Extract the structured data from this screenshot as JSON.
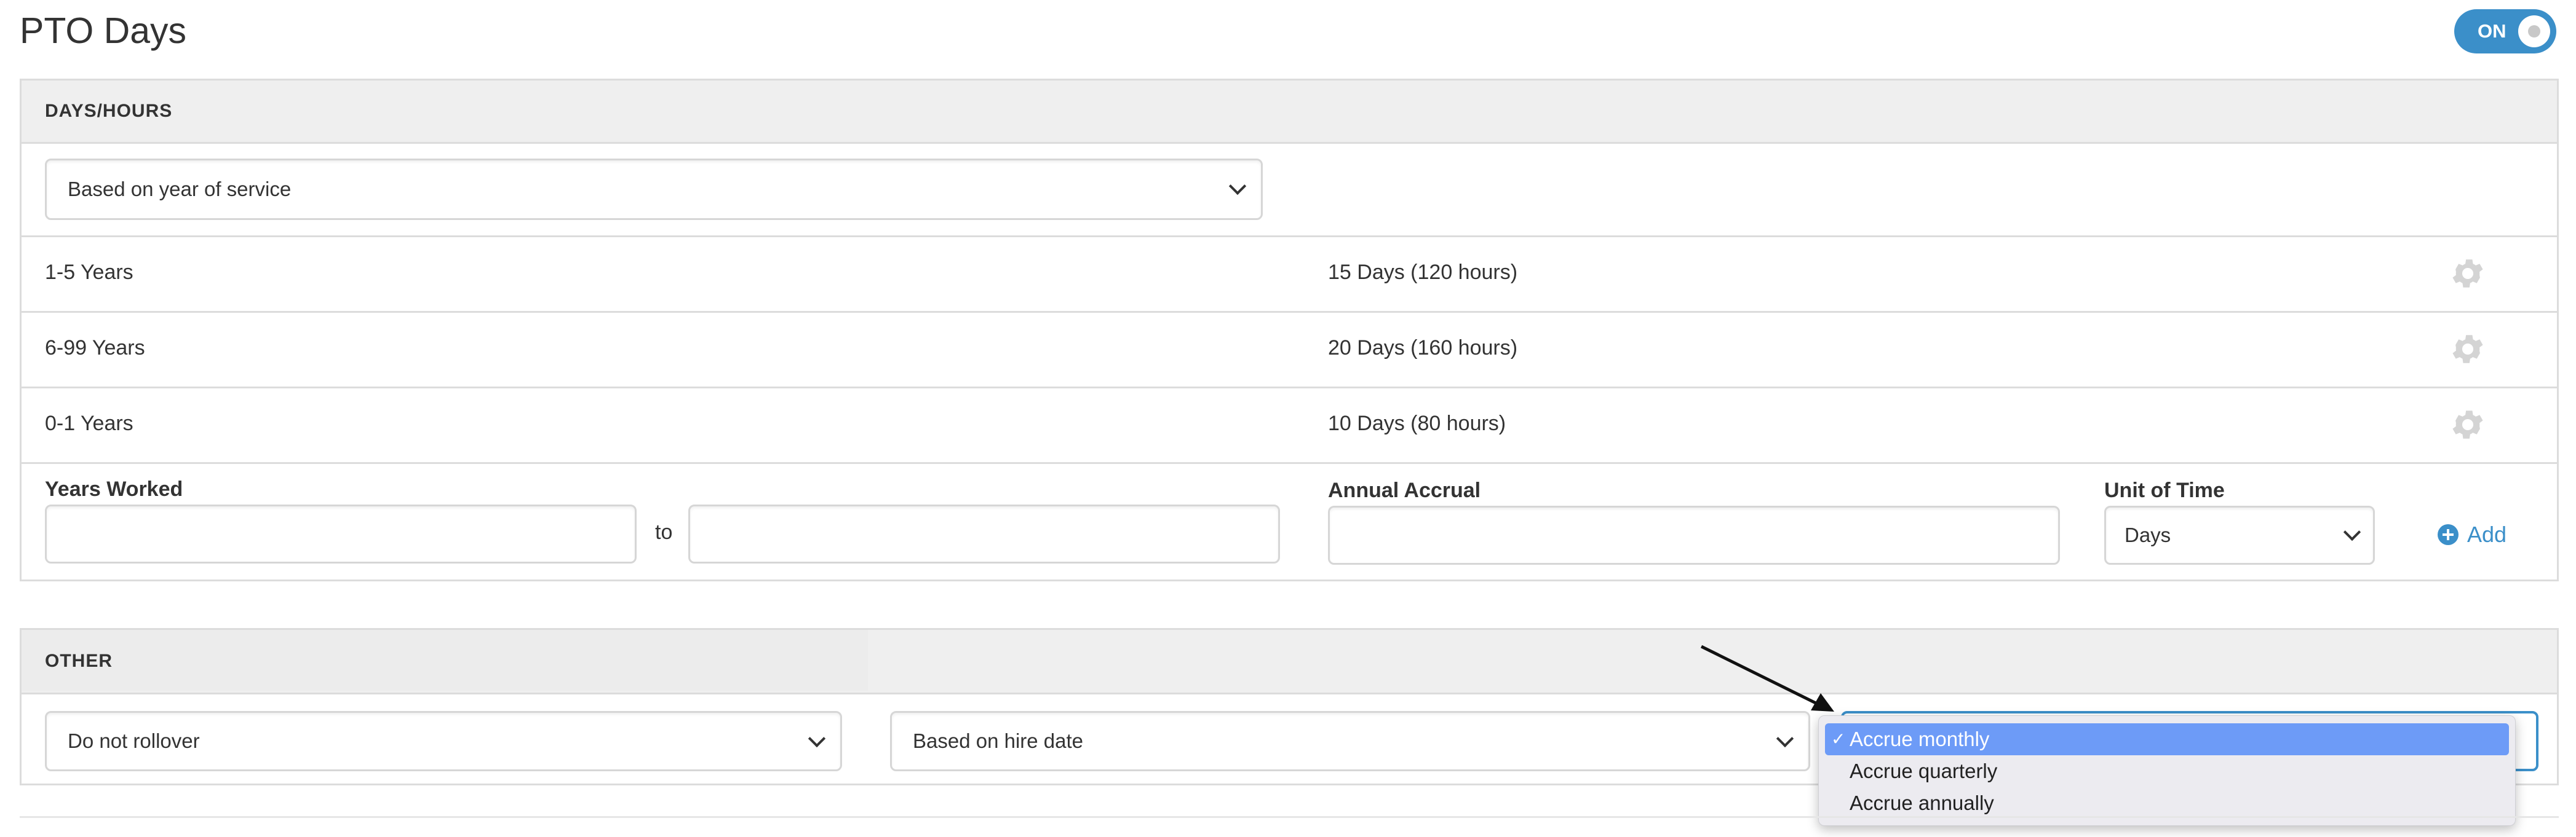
{
  "page": {
    "title": "PTO Days"
  },
  "toggle": {
    "label": "ON",
    "state": "on",
    "color": "#3b8fc9"
  },
  "days_hours": {
    "header": "DAYS/HOURS",
    "policy_select": {
      "value": "Based on year of service"
    },
    "rows": [
      {
        "years": "1-5 Years",
        "accrual": "15 Days (120 hours)"
      },
      {
        "years": "6-99 Years",
        "accrual": "20 Days (160 hours)"
      },
      {
        "years": "0-1 Years",
        "accrual": "10 Days (80 hours)"
      }
    ],
    "form": {
      "years_worked_label": "Years Worked",
      "to_label": "to",
      "annual_accrual_label": "Annual Accrual",
      "unit_label": "Unit of Time",
      "unit_value": "Days",
      "add_label": "Add"
    }
  },
  "other": {
    "header": "OTHER",
    "rollover_select": {
      "value": "Do not rollover"
    },
    "basis_select": {
      "value": "Based on hire date"
    },
    "accrual_dropdown": {
      "options": [
        "Accrue monthly",
        "Accrue quarterly",
        "Accrue annually"
      ],
      "selected": "Accrue monthly",
      "check_glyph": "✓"
    }
  },
  "colors": {
    "accent": "#3b8fc9",
    "menu_highlight": "#6d9bf7",
    "header_bg": "#efefef",
    "gear": "#d4d4d4"
  }
}
